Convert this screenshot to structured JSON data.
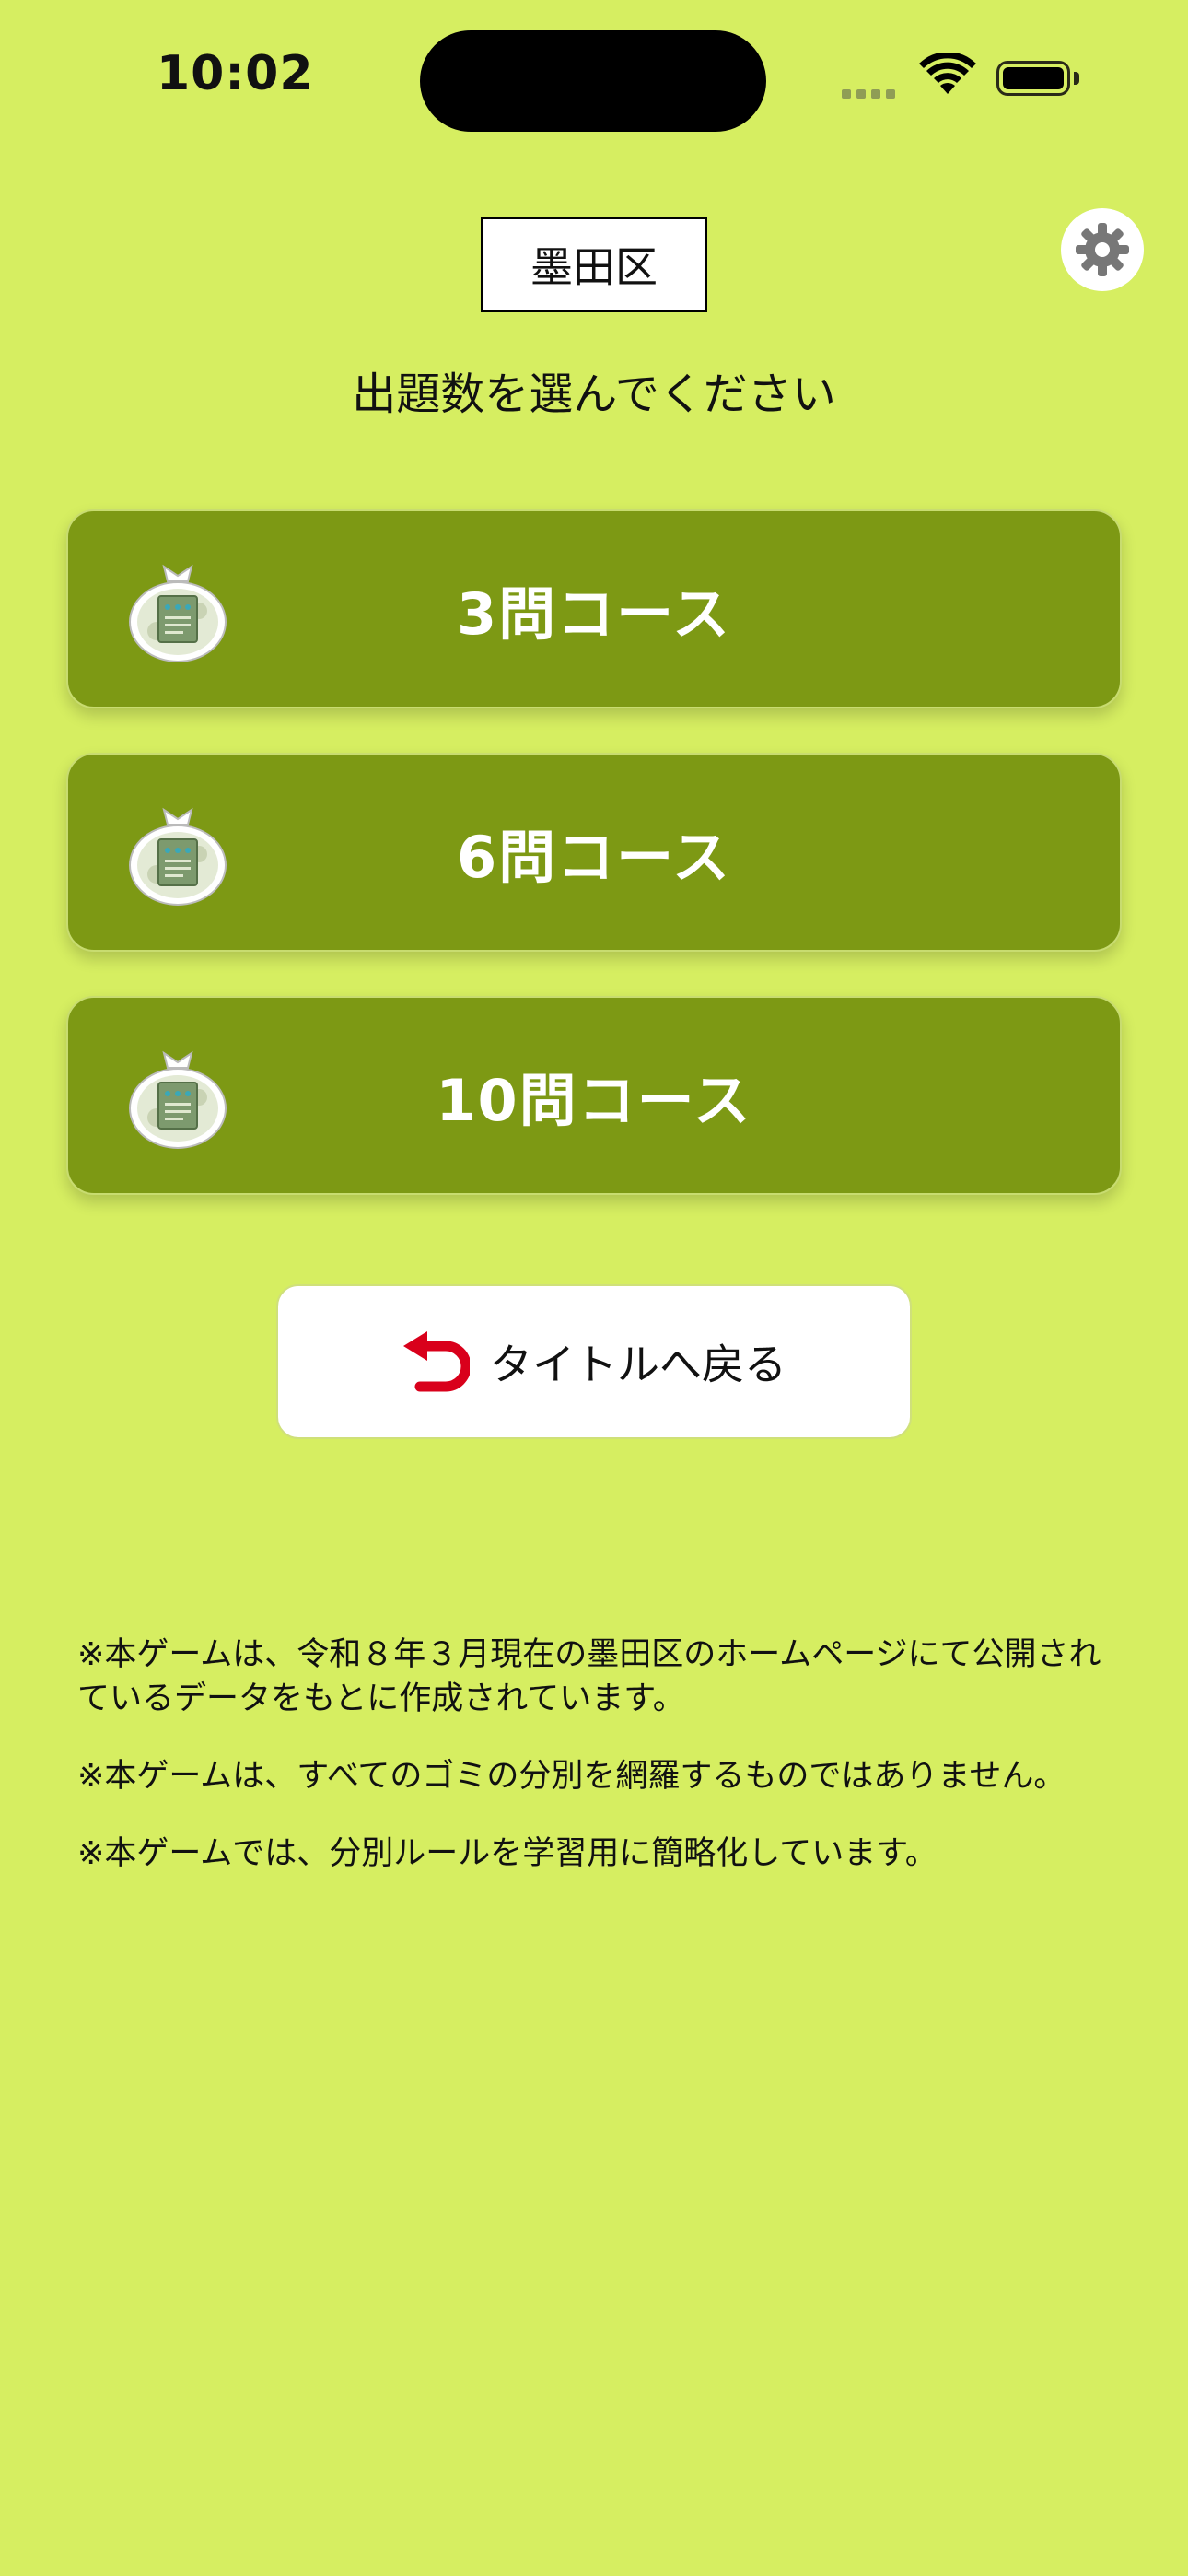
{
  "status_bar": {
    "time": "10:02"
  },
  "header": {
    "region": "墨田区",
    "prompt": "出題数を選んでください"
  },
  "icons": {
    "settings": "gear-icon",
    "course": "trash-bag-icon",
    "back": "return-arrow-icon"
  },
  "courses": [
    {
      "label": "3問コース"
    },
    {
      "label": "6問コース"
    },
    {
      "label": "10問コース"
    }
  ],
  "back_button": {
    "label": "タイトルへ戻る"
  },
  "notes": [
    "※本ゲームは、令和８年３月現在の墨田区のホームページにて公開されているデータをもとに作成されています。",
    "※本ゲームは、すべてのゴミの分別を網羅するものではありません。",
    "※本ゲームでは、分別ルールを学習用に簡略化しています。"
  ],
  "colors": {
    "background": "#d6ee61",
    "course_button": "#7d9914",
    "back_arrow": "#d9001b"
  }
}
